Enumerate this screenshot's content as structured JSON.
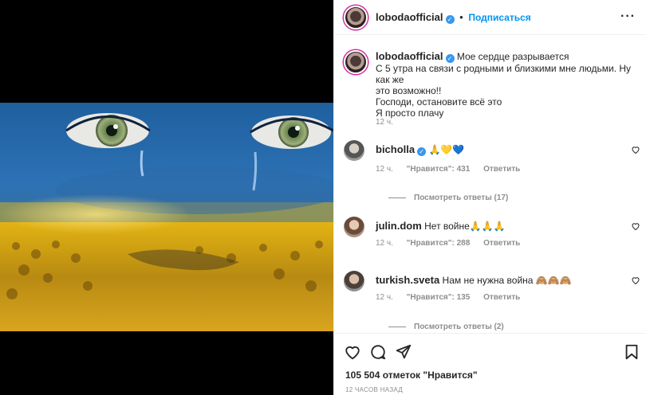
{
  "post": {
    "username": "lobodaofficial",
    "verified_mark": "✓",
    "separator": "•",
    "follow_label": "Подписаться",
    "more_icon": "more-horizontal-icon",
    "more_label": "···"
  },
  "caption": {
    "username": "lobodaofficial",
    "lines": [
      "Мое сердце разрывается",
      "С 5 утра на связи с родными и близкими мне людьми. Ну как же",
      "это возможно!!",
      "Господи, остановите всё это",
      "Я просто плачу"
    ],
    "time": "12 ч."
  },
  "comments": [
    {
      "username": "bicholla",
      "verified": true,
      "text": "🙏💛💙",
      "time": "12 ч.",
      "likes": "\"Нравится\": 431",
      "reply": "Ответить",
      "view_replies": "Посмотреть ответы (17)"
    },
    {
      "username": "julin.dom",
      "verified": false,
      "text": "Нет войне🙏🙏🙏",
      "time": "12 ч.",
      "likes": "\"Нравится\": 288",
      "reply": "Ответить"
    },
    {
      "username": "turkish.sveta",
      "verified": false,
      "text": "Нам не нужна война 🙈🙈🙈",
      "time": "12 ч.",
      "likes": "\"Нравится\": 135",
      "reply": "Ответить",
      "view_replies": "Посмотреть ответы (2)"
    }
  ],
  "actions": {
    "like_icon": "heart-icon",
    "comment_icon": "comment-icon",
    "share_icon": "share-icon",
    "save_icon": "bookmark-icon",
    "likes_count": "105 504 отметок \"Нравится\"",
    "time_ago": "12 ЧАСОВ НАЗАД"
  },
  "colors": {
    "accent": "#0095f6",
    "verified": "#3897f0",
    "muted": "#8e8e8e",
    "text": "#262626",
    "flag_blue": "#2b6fb3",
    "flag_yellow": "#f2c200"
  }
}
